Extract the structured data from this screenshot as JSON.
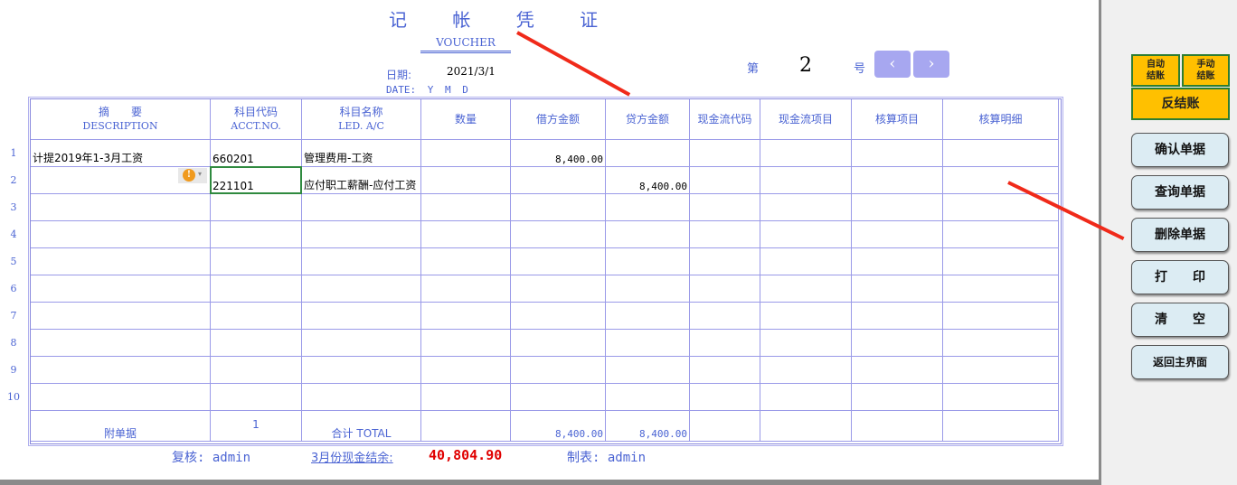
{
  "header": {
    "title": "记 帐 凭 证",
    "subtitle": "VOUCHER",
    "date_label": "日期:",
    "date_value": "2021/3/1",
    "date_ymd": "DATE: Y M D",
    "number_prefix": "第",
    "number": "2",
    "number_suffix": "号",
    "prev_icon": "chevron-left-icon",
    "next_icon": "chevron-right-icon"
  },
  "columns": [
    {
      "cn": "摘　　要",
      "en": "DESCRIPTION"
    },
    {
      "cn": "科目代码",
      "en": "ACCT.NO."
    },
    {
      "cn": "科目名称",
      "en": "LED. A/C"
    },
    {
      "cn": "数量",
      "en": ""
    },
    {
      "cn": "借方金额",
      "en": ""
    },
    {
      "cn": "贷方金额",
      "en": ""
    },
    {
      "cn": "现金流代码",
      "en": ""
    },
    {
      "cn": "现金流项目",
      "en": ""
    },
    {
      "cn": "核算项目",
      "en": ""
    },
    {
      "cn": "核算明细",
      "en": ""
    }
  ],
  "rows": [
    [
      "计提2019年1-3月工资",
      "660201",
      "管理费用-工资",
      "",
      "8,400.00",
      "",
      "",
      "",
      "",
      ""
    ],
    [
      "",
      "221101",
      "应付职工薪酬-应付工资",
      "",
      "",
      "8,400.00",
      "",
      "",
      "",
      ""
    ],
    [
      "",
      "",
      "",
      "",
      "",
      "",
      "",
      "",
      "",
      ""
    ],
    [
      "",
      "",
      "",
      "",
      "",
      "",
      "",
      "",
      "",
      ""
    ],
    [
      "",
      "",
      "",
      "",
      "",
      "",
      "",
      "",
      "",
      ""
    ],
    [
      "",
      "",
      "",
      "",
      "",
      "",
      "",
      "",
      "",
      ""
    ],
    [
      "",
      "",
      "",
      "",
      "",
      "",
      "",
      "",
      "",
      ""
    ],
    [
      "",
      "",
      "",
      "",
      "",
      "",
      "",
      "",
      "",
      ""
    ],
    [
      "",
      "",
      "",
      "",
      "",
      "",
      "",
      "",
      "",
      ""
    ],
    [
      "",
      "",
      "",
      "",
      "",
      "",
      "",
      "",
      "",
      ""
    ]
  ],
  "row_numbers": [
    "1",
    "2",
    "3",
    "4",
    "5",
    "6",
    "7",
    "8",
    "9",
    "10"
  ],
  "totals": {
    "attach_label": "附单据",
    "attach_count": "1",
    "total_label": "合计  TOTAL",
    "debit": "8,400.00",
    "credit": "8,400.00"
  },
  "footer": {
    "reviewer": "复核: admin",
    "cash_label": "3月份现金结余:",
    "cash_value": "40,804.90",
    "maker": "制表: admin"
  },
  "panel": {
    "auto_close": "自动\n结账",
    "manual_close": "手动\n结账",
    "reverse_close": "反结账",
    "buttons": [
      "确认单据",
      "查询单据",
      "删除单据",
      "打　　印",
      "清　　空",
      "返回主界面"
    ]
  },
  "colors": {
    "accent": "#4a63d3",
    "cash": "#e00000",
    "button_yellow": "#ffc000",
    "button_blue": "#dcecf3"
  }
}
